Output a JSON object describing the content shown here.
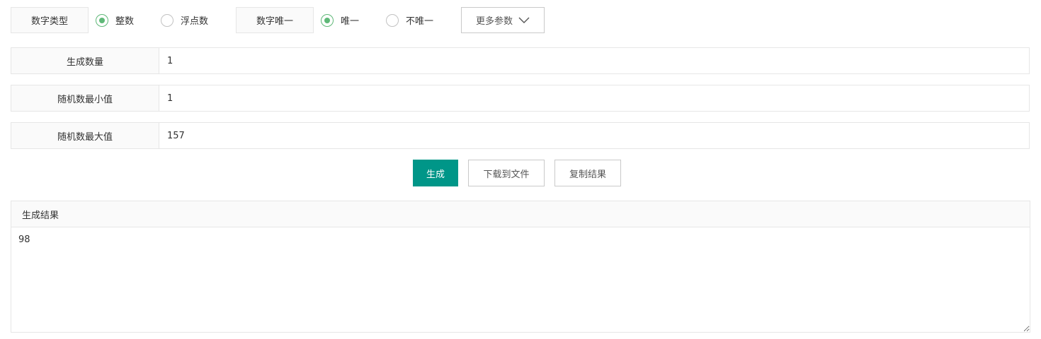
{
  "options": {
    "number_type_label": "数字类型",
    "number_type_choices": [
      {
        "label": "整数",
        "checked": true
      },
      {
        "label": "浮点数",
        "checked": false
      }
    ],
    "unique_label": "数字唯一",
    "unique_choices": [
      {
        "label": "唯一",
        "checked": true
      },
      {
        "label": "不唯一",
        "checked": false
      }
    ],
    "more_params_label": "更多参数",
    "more_params_icon": "chevron-down-icon",
    "accent_color": "#5fb878"
  },
  "fields": {
    "count": {
      "label": "生成数量",
      "value": "1"
    },
    "min": {
      "label": "随机数最小值",
      "value": "1"
    },
    "max": {
      "label": "随机数最大值",
      "value": "157"
    }
  },
  "actions": {
    "generate_label": "生成",
    "download_label": "下载到文件",
    "copy_label": "复制结果",
    "primary_color": "#009688"
  },
  "result": {
    "title": "生成结果",
    "value": "98"
  }
}
